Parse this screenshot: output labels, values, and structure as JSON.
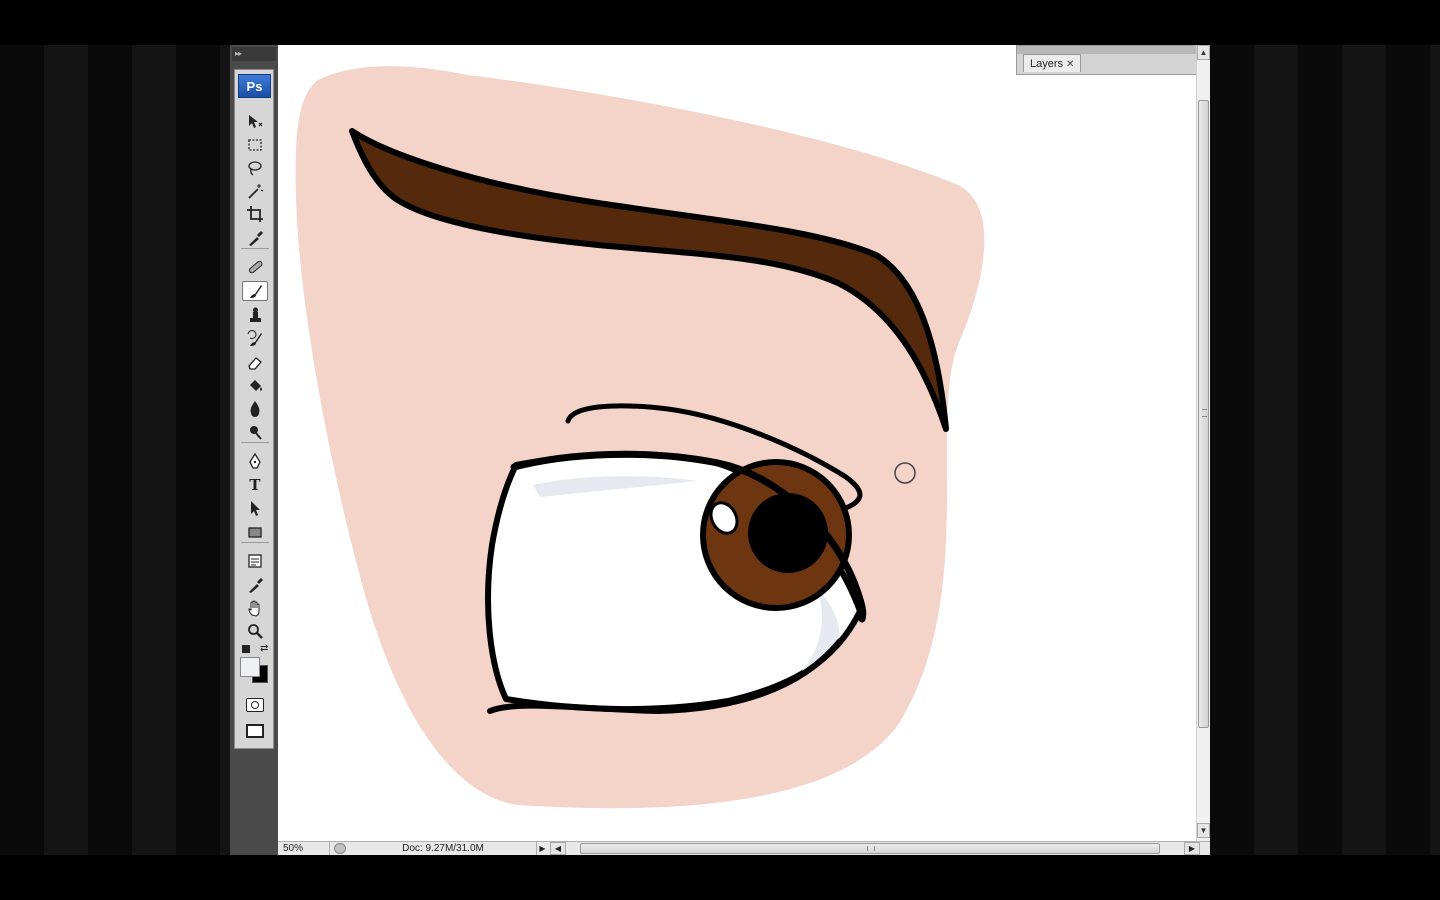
{
  "app": {
    "logo_text": "Ps",
    "tools_collapse_glyph": "▸▸"
  },
  "tools": [
    {
      "name": "move-tool",
      "icon": "move-icon"
    },
    {
      "name": "marquee-tool",
      "icon": "marquee-icon"
    },
    {
      "name": "lasso-tool",
      "icon": "lasso-icon"
    },
    {
      "name": "magic-wand-tool",
      "icon": "magic-wand-icon"
    },
    {
      "name": "crop-tool",
      "icon": "crop-icon"
    },
    {
      "name": "eyedropper-tool",
      "icon": "eyedropper-icon"
    },
    {
      "name": "healing-brush-tool",
      "icon": "bandage-icon"
    },
    {
      "name": "brush-tool",
      "icon": "brush-icon",
      "active": true
    },
    {
      "name": "clone-stamp-tool",
      "icon": "stamp-icon"
    },
    {
      "name": "history-brush-tool",
      "icon": "history-brush-icon"
    },
    {
      "name": "eraser-tool",
      "icon": "eraser-icon"
    },
    {
      "name": "paint-bucket-tool",
      "icon": "bucket-icon"
    },
    {
      "name": "blur-tool",
      "icon": "blur-icon"
    },
    {
      "name": "dodge-tool",
      "icon": "dodge-icon"
    },
    {
      "name": "pen-tool",
      "icon": "pen-icon"
    },
    {
      "name": "type-tool",
      "icon": "type-icon",
      "label": "T"
    },
    {
      "name": "path-selection-tool",
      "icon": "arrow-icon"
    },
    {
      "name": "shape-tool",
      "icon": "rectangle-icon"
    },
    {
      "name": "notes-tool",
      "icon": "notes-icon"
    },
    {
      "name": "3d-eyedropper-tool",
      "icon": "eyedropper-icon"
    },
    {
      "name": "hand-tool",
      "icon": "hand-icon"
    },
    {
      "name": "zoom-tool",
      "icon": "magnifier-icon"
    }
  ],
  "colors": {
    "foreground": "#eef0f4",
    "background": "#000000",
    "skin": "#f4d3c9",
    "brow": "#552a0c",
    "iris": "#6e3511",
    "outline": "#000000",
    "eye_shadow": "#e6eaf0"
  },
  "layers_panel": {
    "tab_label": "Layers",
    "close_glyph": "✕",
    "menu_glyph": "▾≡"
  },
  "status_bar": {
    "zoom": "50%",
    "doc_info": "Doc: 9.27M/31.0M",
    "menu_glyph": "▶"
  },
  "scrollbars": {
    "up_glyph": "▲",
    "down_glyph": "▼",
    "left_glyph": "◀",
    "right_glyph": "▶"
  }
}
